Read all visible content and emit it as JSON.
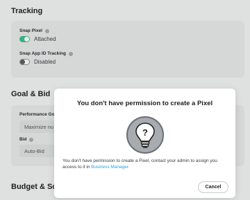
{
  "tracking": {
    "title": "Tracking",
    "snap_pixel": {
      "label": "Snap Pixel",
      "status": "Attached",
      "on": true
    },
    "app_id": {
      "label": "Snap App ID Tracking",
      "status": "Disabled",
      "on": false
    }
  },
  "goal_bid": {
    "title": "Goal & Bid",
    "performance_goal": {
      "label": "Performance Goa",
      "value": "Maximize nu"
    },
    "bid": {
      "label": "Bid",
      "value": "Auto-Bid"
    }
  },
  "budget": {
    "title": "Budget & Sche"
  },
  "modal": {
    "title": "You don't have permission to create a Pixel",
    "icon": "lightbulb-question-icon",
    "body_text": "You don't have permission to create a Pixel, contact your admin to assign you access to it in",
    "link_text": "Business Manager.",
    "cancel_label": "Cancel"
  },
  "colors": {
    "accent": "#3fbf8e",
    "link": "#2e9fd6"
  }
}
